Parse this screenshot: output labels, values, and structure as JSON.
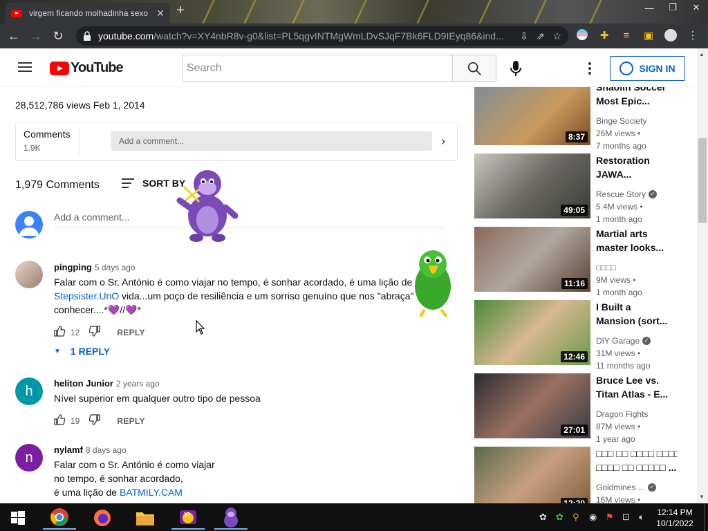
{
  "browser": {
    "tab_title": "virgem ficando molhadinha sexo",
    "tab_close": "✕",
    "new_tab": "+",
    "url_host": "youtube.com",
    "url_path": "/watch?v=XY4nbR8v-g0&list=PL5qgvINTMgWmLDvSJqF7Bk6FLD9IEyq86&ind..."
  },
  "youtube": {
    "logo_text": "YouTube",
    "search_placeholder": "Search",
    "sign_in": "SIGN IN"
  },
  "video": {
    "views_date": "28,512,786 views  Feb 1, 2014"
  },
  "comments_box": {
    "title": "Comments",
    "count": "1.9K",
    "input_placeholder": "Add a comment..."
  },
  "comments": {
    "header_count": "1,979 Comments",
    "sort_label": "SORT BY",
    "add_placeholder": "Add a comment...",
    "items": [
      {
        "author": "pingping",
        "time": "5 days ago",
        "line1": "Falar com o Sr. António é como viajar   no tempo, é sonhar acordado, é uma lição de",
        "link": "Stepsister.UnO",
        "line2": " vida...um poço de resiliência e um sorriso genuíno que nos \"abraça\"",
        "line3": "conhecer....*💜//💜*",
        "likes": "12",
        "reply": "REPLY",
        "replies": "1 REPLY"
      },
      {
        "author": "heliton Junior",
        "avatar_letter": "h",
        "time": "2 years ago",
        "line1": "Nível superior em qualquer outro tipo de pessoa",
        "likes": "19",
        "reply": "REPLY"
      },
      {
        "author": "nylamf",
        "avatar_letter": "n",
        "time": "8 days ago",
        "line1": "Falar com o Sr. António é como viajar",
        "line2": "no tempo, é sonhar acordado,",
        "line3": "é uma lição de ",
        "link": "BATMILY.CAM"
      }
    ]
  },
  "sidebar": {
    "videos": [
      {
        "title1": "Shaolin Soccer",
        "title2": "Most Epic...",
        "channel": "Binge Society",
        "views": "26M views •",
        "age": "7 months ago",
        "duration": "8:37",
        "verified": false
      },
      {
        "title1": "Restoration",
        "title2": "JAWA...",
        "channel": "Rescue Story",
        "views": "5.4M views •",
        "age": "1 month ago",
        "duration": "49:05",
        "verified": true
      },
      {
        "title1": "Martial arts",
        "title2": "master looks...",
        "channel": "□□□□",
        "views": "9M views •",
        "age": "1 month ago",
        "duration": "11:16",
        "verified": false
      },
      {
        "title1": "I Built a",
        "title2": "Mansion (sort...",
        "channel": "DIY Garage",
        "views": "31M views •",
        "age": "11 months ago",
        "duration": "12:46",
        "verified": true
      },
      {
        "title1": "Bruce Lee vs.",
        "title2": "Titan Atlas - E...",
        "channel": "Dragon Fights",
        "views": "87M views •",
        "age": "1 year ago",
        "duration": "27:01",
        "verified": false
      },
      {
        "title1": "□□□ □□ □□□□ □□□□",
        "title2": "□□□□ □□ □□□□□ ...",
        "channel": "Goldmines ...",
        "views": "16M views •",
        "age": "",
        "duration": "12:20",
        "verified": true
      }
    ]
  },
  "taskbar": {
    "time": "12:14 PM",
    "date": "10/1/2022"
  }
}
